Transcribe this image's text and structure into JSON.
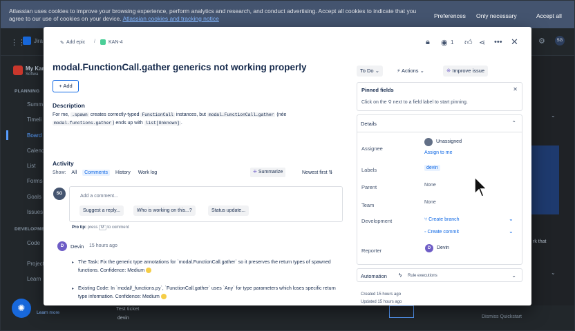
{
  "cookie_banner": {
    "text": "Atlassian uses cookies to improve your browsing experience, perform analytics and research, and conduct advertising. Accept all cookies to indicate that you agree to our use of cookies on your device.",
    "link": "Atlassian cookies and tracking notice",
    "preferences": "Preferences",
    "only_necessary": "Only necessary",
    "accept_all": "Accept all"
  },
  "background": {
    "app_name": "Jira",
    "project_name": "My Kan",
    "project_sub": "Softwa",
    "planning_head": "PLANNING",
    "sidebar": [
      "Summ",
      "Timeli",
      "Board",
      "Calend",
      "List",
      "Forms",
      "Goals",
      "Issues"
    ],
    "development_head": "DEVELOPMEN",
    "dev_items": [
      "Code"
    ],
    "extra_items": [
      "Project",
      "Learn"
    ],
    "learn_more": "Learn more",
    "test_ticket": "Test ticket",
    "devin_row": "devin",
    "dismiss": "Dismiss Quickstart",
    "right_snippet": "rk that",
    "avatar": "SG"
  },
  "modal": {
    "breadcrumb_add_epic": "Add epic",
    "breadcrumb_sep": "/",
    "issue_key": "KAN-4",
    "watch_count": "1",
    "title": "modal.FunctionCall.gather generics not working properly",
    "add_label": "+ Add",
    "description": {
      "heading": "Description",
      "p1": "For me,",
      "c1": ".spawn",
      "p2": "creates correctly-typed",
      "c2": "FunctionCall",
      "p3": "instances, but",
      "c3": "modal.FunctionCall.gather",
      "p4": "(née",
      "c4": "modal.functions.gather",
      "p5": ") ends up with",
      "c5": "list[Unknown]",
      "p6": "."
    },
    "activity": {
      "heading": "Activity",
      "show_label": "Show:",
      "filters": [
        "All",
        "Comments",
        "History",
        "Work log"
      ],
      "summarize": "Summarize",
      "sort": "Newest first",
      "current_user_initials": "SG",
      "comment_placeholder": "Add a comment...",
      "suggestions": [
        "Suggest a reply...",
        "Who is working on this...?",
        "Status update..."
      ],
      "protip_prefix": "Pro tip:",
      "protip_press": "press",
      "protip_key": "M",
      "protip_suffix": "to comment",
      "comment": {
        "author_initial": "D",
        "author": "Devin",
        "time": "15 hours ago",
        "bullet1": "The Task: Fix the generic type annotations for `modal.FunctionCall.gather` so it preserves the return types of spawned functions. Confidence: Medium",
        "bullet2": "Existing Code: In `modal/_functions.py`, `FunctionCall.gather` uses `Any` for type parameters which loses specific return type information. Confidence: Medium"
      }
    },
    "sidebar": {
      "status": "To Do",
      "actions": "Actions",
      "improve": "Improve issue",
      "pinned_heading": "Pinned fields",
      "pinned_text": "Click on the",
      "pinned_text2": "next to a field label to start pinning.",
      "details_heading": "Details",
      "fields": {
        "assignee_label": "Assignee",
        "assignee_value": "Unassigned",
        "assign_to_me": "Assign to me",
        "labels_label": "Labels",
        "labels_value": "devin",
        "parent_label": "Parent",
        "parent_value": "None",
        "team_label": "Team",
        "team_value": "None",
        "development_label": "Development",
        "create_branch": "Create branch",
        "create_commit": "Create commit",
        "reporter_label": "Reporter",
        "reporter_initial": "D",
        "reporter_value": "Devin"
      },
      "automation_heading": "Automation",
      "automation_rule": "Rule executions",
      "created": "Created 15 hours ago",
      "updated": "Updated 15 hours ago"
    }
  }
}
